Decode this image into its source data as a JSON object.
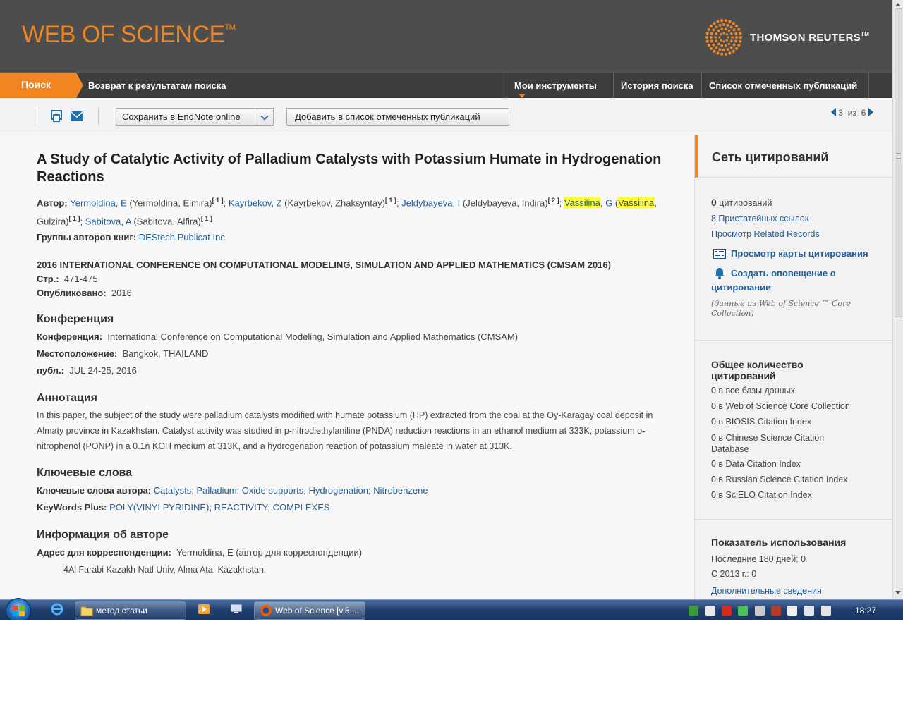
{
  "header": {
    "logo": "WEB OF SCIENCE",
    "logo_tm": "TM",
    "brand": "THOMSON REUTERS",
    "brand_tm": "TM"
  },
  "nav": {
    "search": "Поиск",
    "back": "Возврат к результатам поиска",
    "tools": "Мои инструменты",
    "history": "История поиска",
    "marked": "Список отмеченных публикаций"
  },
  "toolbar": {
    "endnote": "Сохранить в EndNote online",
    "add_marked": "Добавить в список отмеченных публикаций",
    "page_current": "3",
    "page_of": "из",
    "page_total": "6"
  },
  "record": {
    "title": "A Study of Catalytic Activity of Palladium Catalysts with Potassium Humate in Hydrogenation Reactions",
    "author_label": "Автор:",
    "authors": [
      {
        "short": "Yermoldina, E",
        "full": " (Yermoldina, Elmira)",
        "ref": "[ 1 ]"
      },
      {
        "short": "Kayrbekov, Z",
        "full": " (Kayrbekov, Zhaksyntay)",
        "ref": "[ 1 ]"
      },
      {
        "short": "Jeldybayeva, I",
        "full": " (Jeldybayeva, Indira)",
        "ref": "[ 2 ]"
      },
      {
        "short_hl": "Vassilina",
        "short_rest": ", G",
        "full_hl": "Vassilina",
        "full_rest": ", Gulzira)",
        "ref": "[ 1 ]"
      },
      {
        "short": "Sabitova, A",
        "full": " (Sabitova, Alfira)",
        "ref": "[ 1 ]"
      }
    ],
    "group_label": "Группы авторов книг:",
    "group": "DEStech Publicat Inc",
    "conference_title": "2016 INTERNATIONAL CONFERENCE ON COMPUTATIONAL MODELING, SIMULATION AND APPLIED MATHEMATICS (CMSAM 2016)",
    "pages_label": "Стр.:",
    "pages": "471-475",
    "published_label": "Опубликовано:",
    "published": "2016",
    "conf_section": "Конференция",
    "conf_label": "Конференция:",
    "conf": "International Conference on Computational Modeling, Simulation and Applied Mathematics (CMSAM)",
    "location_label": "Местоположение:",
    "location": "Bangkok, THAILAND",
    "date_label": "публ.:",
    "date": "JUL 24-25, 2016",
    "abstract_section": "Аннотация",
    "abstract": "In this paper, the subject of the study were palladium catalysts modified with humate potassium (HP) extracted from the coal at the Oy-Karagay coal deposit in Almaty province in Kazakhstan. Catalyst activity was studied in p-nitrodiethylaniline (PNDA) reduction reactions in an ethanol medium at 333K, potassium o-nitrophenol (PONP) in a 0.1n KOH medium at 313K, and a hydrogenation reaction of potassium maleate in water at 313K.",
    "keywords_section": "Ключевые слова",
    "author_kw_label": "Ключевые слова автора:",
    "author_keywords": [
      "Catalysts",
      "Palladium",
      "Oxide supports",
      "Hydrogenation",
      "Nitrobenzene"
    ],
    "kwplus_label": "KeyWords Plus:",
    "kwplus": [
      "POLY(VINYLPYRIDINE)",
      "REACTIVITY",
      "COMPLEXES"
    ],
    "author_info_section": "Информация об авторе",
    "corr_label": "Адрес для корреспонденции:",
    "corr": "Yermoldina, E (автор для корреспонденции)",
    "address": "4Al Farabi Kazakh Natl Univ, Alma Ata, Kazakhstan."
  },
  "side": {
    "title": "Сеть цитирований",
    "citations_count": "0",
    "citations_label": "цитирований",
    "refs": "8 Пристатейных ссылок",
    "related": "Просмотр Related Records",
    "map": "Просмотр карты цитирования",
    "alert": "Создать оповещение о цитировании",
    "note": "(данные из Web of Science ™ Core Collection)",
    "total_title": "Общее количество цитирований",
    "totals": [
      "0 в все базы данных",
      "0 в Web of Science Core Collection",
      "0 в BIOSIS Citation Index",
      "0 в Chinese Science Citation Database",
      "0 в Data Citation Index",
      "0 в Russian Science Citation Index",
      "0 в SciELO Citation Index"
    ],
    "usage_title": "Показатель использования",
    "usage_180": "Последние 180 дней: 0",
    "usage_2013": "С 2013 г.: 0",
    "more": "Дополнительные сведения"
  },
  "taskbar": {
    "folder": "метод статьи",
    "firefox": "Web of Science [v.5....",
    "clock": "18:27"
  },
  "colors": {
    "accent": "#f08521",
    "header_bg": "#4d4d4d",
    "nav_bg": "#3d3d3d",
    "link": "#1f5f9e",
    "highlight": "#ffff33"
  }
}
